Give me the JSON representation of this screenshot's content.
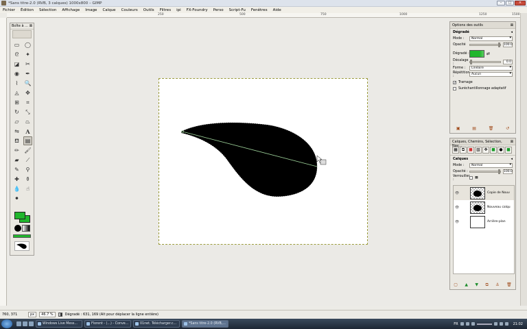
{
  "window": {
    "title": "*Sans titre-2.0 (RVB, 3 calques) 1000x800 – GIMP"
  },
  "menu": [
    "Fichier",
    "Édition",
    "Sélection",
    "Affichage",
    "Image",
    "Calque",
    "Couleurs",
    "Outils",
    "Filtres",
    "ipi",
    "FX-Foundry",
    "Perso",
    "Script-Fu",
    "Fenêtres",
    "Aide"
  ],
  "ruler": [
    "250",
    "500",
    "750",
    "1000",
    "1250",
    "1500"
  ],
  "toolbox": {
    "title": "Boîte à ..."
  },
  "tool_options": {
    "panel_title": "Options des outils",
    "tool_name": "Dégradé",
    "mode_label": "Mode :",
    "mode_value": "Normal",
    "opacity_label": "Opacité",
    "opacity_value": "100.0",
    "opacity_level": 1.0,
    "gradient_label": "Dégradé :",
    "offset_label": "Décalage :",
    "offset_value": "0.0",
    "offset_level": 0.0,
    "shape_label": "Forme :",
    "shape_value": "Linéaire",
    "repeat_label": "Répétition :",
    "repeat_value": "Aucun",
    "dither_label": "Tramage",
    "dither_checked": true,
    "adaptive_label": "Suréchantillonnage adaptatif",
    "adaptive_checked": false
  },
  "layers_dock": {
    "panel_title": "Calques, Chemins, Sélection, Nav...",
    "section_title": "Calques",
    "mode_label": "Mode :",
    "mode_value": "Normal",
    "opacity_label": "Opacité :",
    "opacity_value": "100.0",
    "opacity_level": 1.0,
    "lock_label": "Verrouiller :",
    "layers": [
      {
        "name": "Copie de Nouv",
        "visible": true
      },
      {
        "name": "Nouveau calqu",
        "visible": true
      },
      {
        "name": "Arrière-plan",
        "visible": true
      }
    ]
  },
  "statusbar": {
    "coords": "760, 371",
    "unit": "px",
    "zoom": "46.7 %",
    "message": "Dégradé : 631, 169 (Alt pour déplacer la ligne entière)"
  },
  "taskbar": {
    "tasks": [
      "Windows Live Mess...",
      "Florent - (...) - Conve...",
      "01net. Télécharger.c...",
      "*Sans titre-2.0 (RVB,..."
    ],
    "active_task": 3,
    "tray_language": "FR",
    "clock": "21:02"
  },
  "colors": {
    "foreground": "#21b62d",
    "background": "#21b62d",
    "selection": "#9a9a3a"
  }
}
